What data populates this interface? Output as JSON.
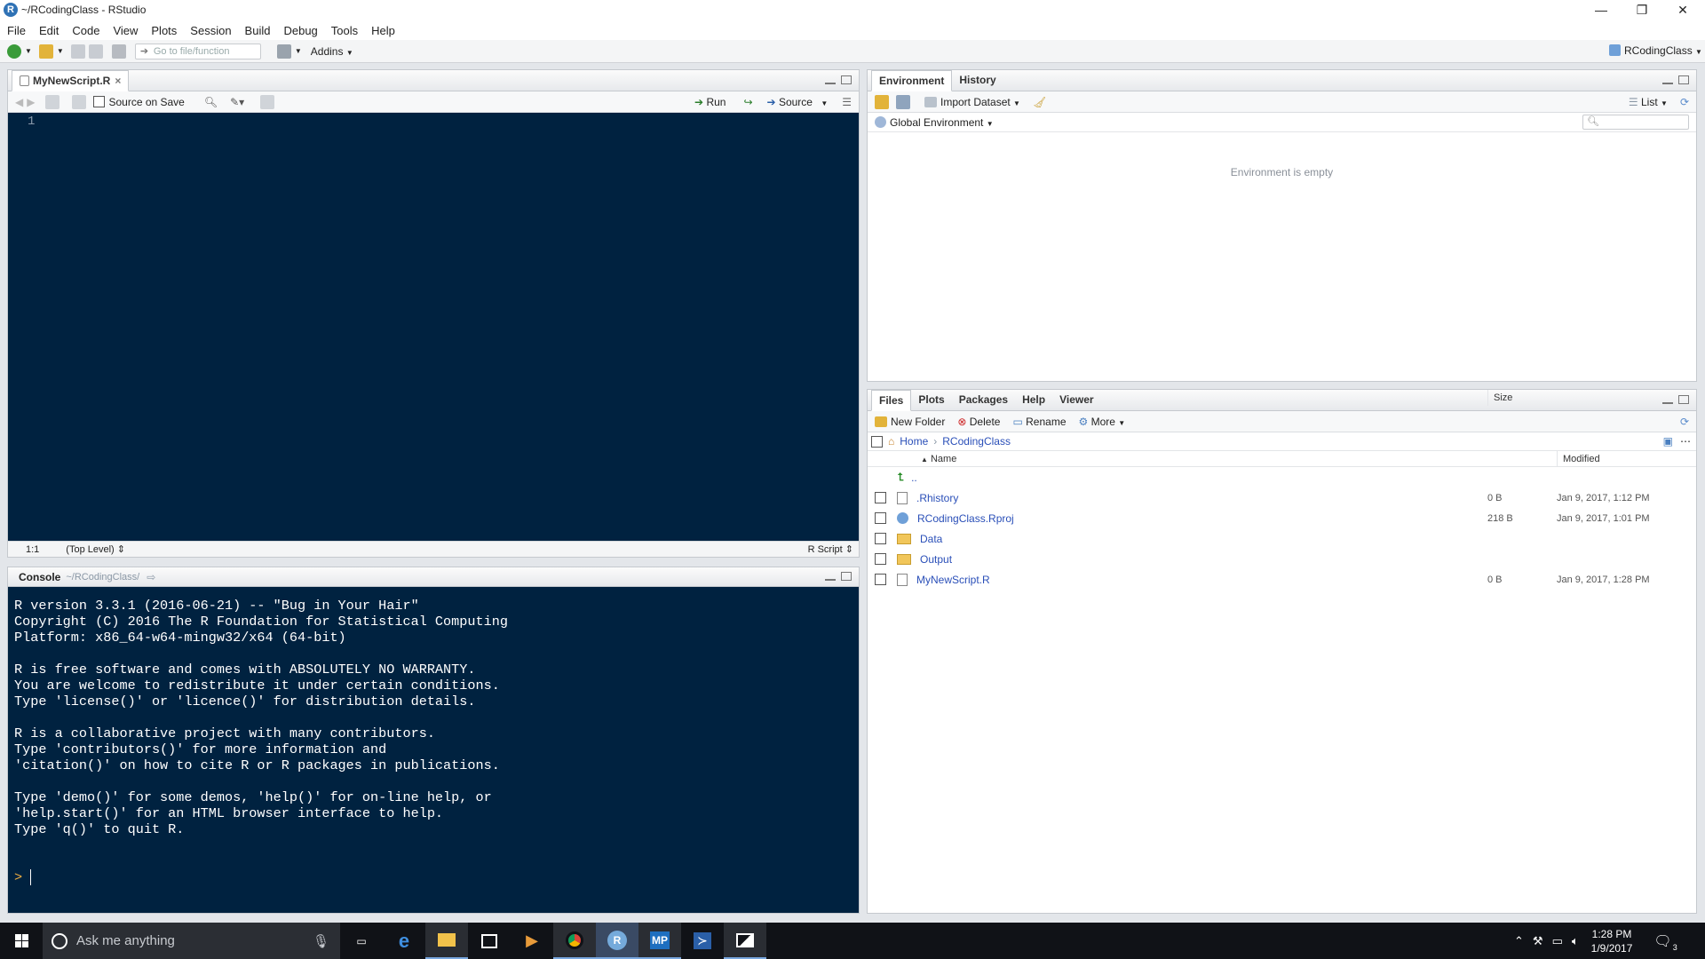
{
  "window": {
    "title": "~/RCodingClass - RStudio",
    "app_icon_letter": "R"
  },
  "menu": [
    "File",
    "Edit",
    "Code",
    "View",
    "Plots",
    "Session",
    "Build",
    "Debug",
    "Tools",
    "Help"
  ],
  "toolbar": {
    "goto_placeholder": "Go to file/function",
    "addins": "Addins",
    "project": "RCodingClass"
  },
  "source_pane": {
    "tab": "MyNewScript.R",
    "source_on_save": "Source on Save",
    "run": "Run",
    "source": "Source",
    "line_number": "1",
    "status_pos": "1:1",
    "status_scope": "(Top Level)",
    "status_type": "R Script"
  },
  "console_pane": {
    "title": "Console",
    "path": "~/RCodingClass/",
    "text": "R version 3.3.1 (2016-06-21) -- \"Bug in Your Hair\"\nCopyright (C) 2016 The R Foundation for Statistical Computing\nPlatform: x86_64-w64-mingw32/x64 (64-bit)\n\nR is free software and comes with ABSOLUTELY NO WARRANTY.\nYou are welcome to redistribute it under certain conditions.\nType 'license()' or 'licence()' for distribution details.\n\nR is a collaborative project with many contributors.\nType 'contributors()' for more information and\n'citation()' on how to cite R or R packages in publications.\n\nType 'demo()' for some demos, 'help()' for on-line help, or\n'help.start()' for an HTML browser interface to help.\nType 'q()' to quit R.",
    "prompt": ">"
  },
  "env_pane": {
    "tabs": [
      "Environment",
      "History"
    ],
    "import_dataset": "Import Dataset",
    "list": "List",
    "global_env": "Global Environment",
    "empty_message": "Environment is empty"
  },
  "files_pane": {
    "tabs": [
      "Files",
      "Plots",
      "Packages",
      "Help",
      "Viewer"
    ],
    "actions": {
      "new_folder": "New Folder",
      "delete": "Delete",
      "rename": "Rename",
      "more": "More"
    },
    "breadcrumb": [
      "Home",
      "RCodingClass"
    ],
    "columns": {
      "name": "Name",
      "size": "Size",
      "modified": "Modified"
    },
    "up": "..",
    "files": [
      {
        "name": ".Rhistory",
        "size": "0 B",
        "modified": "Jan 9, 2017, 1:12 PM",
        "icon": "file-icon"
      },
      {
        "name": "RCodingClass.Rproj",
        "size": "218 B",
        "modified": "Jan 9, 2017, 1:01 PM",
        "icon": "rproj-icon"
      },
      {
        "name": "Data",
        "size": "",
        "modified": "",
        "icon": "folder-icon"
      },
      {
        "name": "Output",
        "size": "",
        "modified": "",
        "icon": "folder-icon"
      },
      {
        "name": "MyNewScript.R",
        "size": "0 B",
        "modified": "Jan 9, 2017, 1:28 PM",
        "icon": "file-icon"
      }
    ]
  },
  "taskbar": {
    "search_placeholder": "Ask me anything",
    "time": "1:28 PM",
    "date": "1/9/2017",
    "notifications": "3"
  }
}
